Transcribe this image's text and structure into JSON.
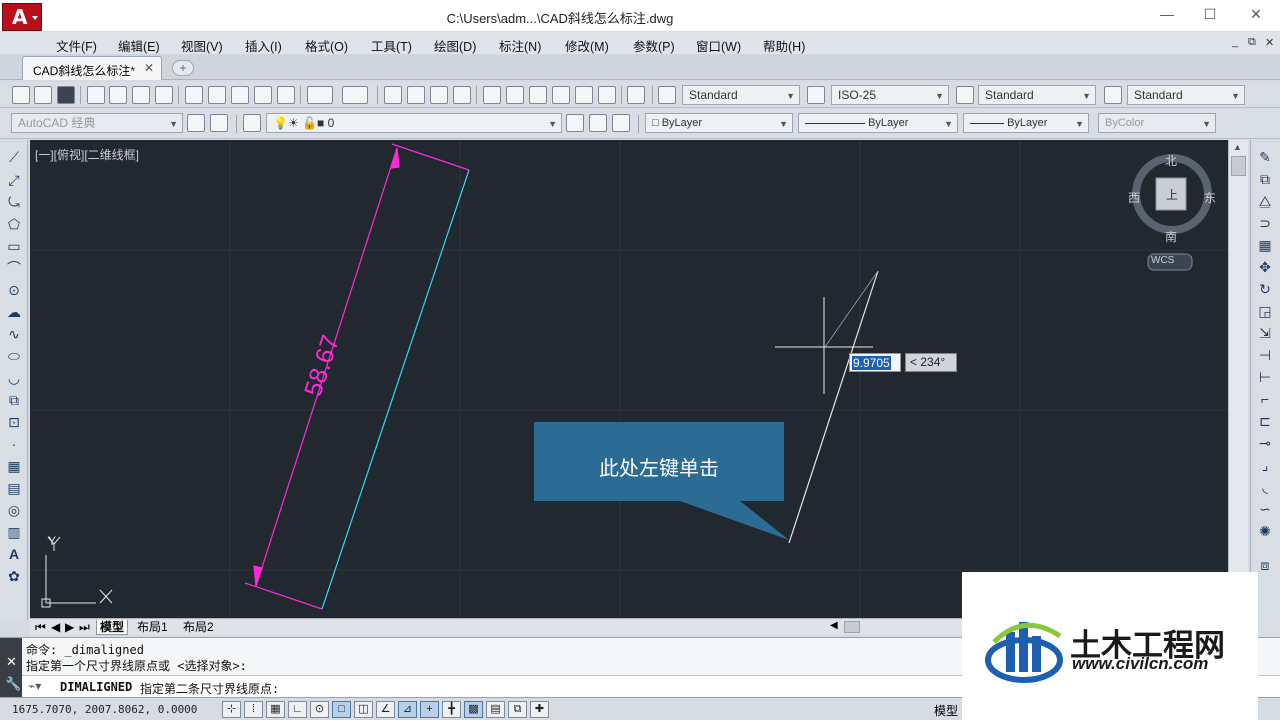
{
  "window": {
    "title": "C:\\Users\\adm...\\CAD斜线怎么标注.dwg",
    "minimize": "—",
    "maximize": "☐",
    "close": "✕",
    "logo": "A"
  },
  "menu": [
    "文件(F)",
    "编辑(E)",
    "视图(V)",
    "插入(I)",
    "格式(O)",
    "工具(T)",
    "绘图(D)",
    "标注(N)",
    "修改(M)",
    "参数(P)",
    "窗口(W)",
    "帮助(H)"
  ],
  "mdi_controls": [
    "_",
    "⧉",
    "✕"
  ],
  "doc_tab": {
    "label": "CAD斜线怎么标注*",
    "close": "✕",
    "new": "+"
  },
  "styles": {
    "text_style": "Standard",
    "dim_style": "ISO-25",
    "table_style": "Standard",
    "mleader_style": "Standard"
  },
  "workspace": "AutoCAD 经典",
  "layer": "0",
  "props": {
    "color": "ByLayer",
    "linetype": "ByLayer",
    "lineweight": "ByLayer",
    "plotstyle": "ByColor"
  },
  "viewport_label": "[一][俯视][二维线框]",
  "drawing": {
    "dimension_text": "58.67",
    "input_value": "9.9705",
    "angle_value": "< 234°",
    "dimension_color": "#ff2bd6",
    "line_color": "#35d7e8",
    "canvas_bg": "#212830"
  },
  "viewcube": {
    "north": "北",
    "south": "南",
    "east": "东",
    "west": "西",
    "top": "上",
    "wcs": "WCS"
  },
  "ucs": {
    "y": "Y",
    "x": "X"
  },
  "callout": {
    "text": "此处左键单击",
    "color": "#2c6b94"
  },
  "layout_tabs": [
    "模型",
    "布局1",
    "布局2"
  ],
  "command": {
    "history": [
      "命令: _dimaligned",
      "指定第一个尺寸界线原点或 <选择对象>:"
    ],
    "current_cmd": "DIMALIGNED",
    "current_prompt": "指定第二条尺寸界线原点:"
  },
  "status": {
    "coords": "1675.7070, 2007.8062, 0.0000",
    "space": "模型"
  },
  "watermark": {
    "name": "土木工程网",
    "url": "www.civilcn.com"
  }
}
